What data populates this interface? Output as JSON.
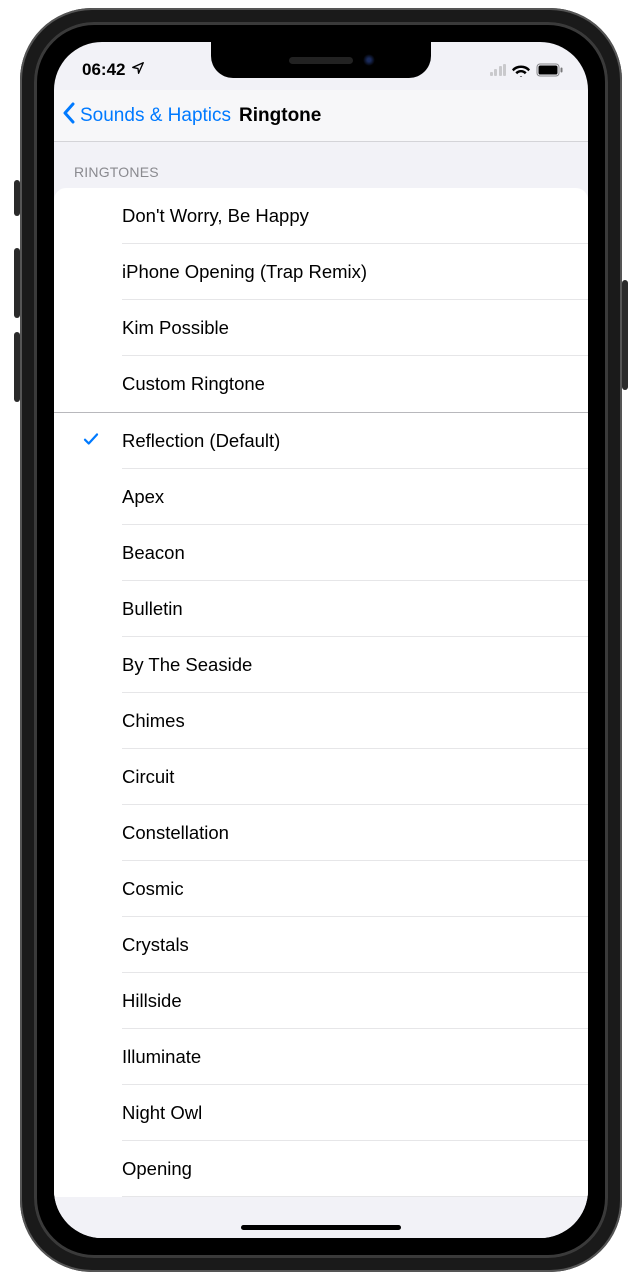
{
  "status_bar": {
    "time": "06:42"
  },
  "nav": {
    "back_label": "Sounds & Haptics",
    "title": "Ringtone"
  },
  "section_header": "RINGTONES",
  "custom_ringtones": [
    {
      "label": "Don't Worry, Be Happy",
      "selected": false
    },
    {
      "label": "iPhone Opening (Trap Remix)",
      "selected": false
    },
    {
      "label": "Kim Possible",
      "selected": false
    },
    {
      "label": "Custom Ringtone",
      "selected": false
    }
  ],
  "system_ringtones": [
    {
      "label": "Reflection (Default)",
      "selected": true
    },
    {
      "label": "Apex",
      "selected": false
    },
    {
      "label": "Beacon",
      "selected": false
    },
    {
      "label": "Bulletin",
      "selected": false
    },
    {
      "label": "By The Seaside",
      "selected": false
    },
    {
      "label": "Chimes",
      "selected": false
    },
    {
      "label": "Circuit",
      "selected": false
    },
    {
      "label": "Constellation",
      "selected": false
    },
    {
      "label": "Cosmic",
      "selected": false
    },
    {
      "label": "Crystals",
      "selected": false
    },
    {
      "label": "Hillside",
      "selected": false
    },
    {
      "label": "Illuminate",
      "selected": false
    },
    {
      "label": "Night Owl",
      "selected": false
    },
    {
      "label": "Opening",
      "selected": false
    }
  ]
}
